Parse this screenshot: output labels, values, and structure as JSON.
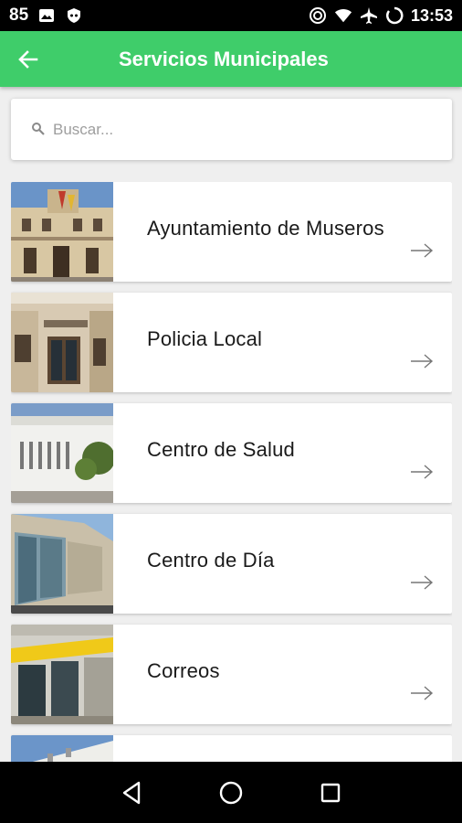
{
  "status_bar": {
    "battery_number": "85",
    "time": "13:53",
    "icons_left": [
      "image-icon",
      "shield-icon"
    ],
    "icons_right": [
      "sync-icon",
      "wifi-icon",
      "airplane-icon",
      "battery-ring-icon"
    ]
  },
  "app_bar": {
    "title": "Servicios Municipales",
    "back_icon": "arrow-left-icon"
  },
  "search": {
    "placeholder": "Buscar...",
    "value": ""
  },
  "items": [
    {
      "label": "Ayuntamiento de Museros",
      "photo": "town-hall-photo"
    },
    {
      "label": "Policia Local",
      "photo": "police-building-photo"
    },
    {
      "label": "Centro de Salud",
      "photo": "health-center-photo"
    },
    {
      "label": "Centro de Día",
      "photo": "day-center-photo"
    },
    {
      "label": "Correos",
      "photo": "post-office-photo"
    },
    {
      "label": "",
      "photo": "building-photo"
    }
  ],
  "nav_bar": {
    "buttons": [
      "back-triangle-icon",
      "home-circle-icon",
      "recents-square-icon"
    ]
  },
  "colors": {
    "app_bar": "#3fcd6a",
    "background": "#efefef",
    "card": "#ffffff"
  }
}
